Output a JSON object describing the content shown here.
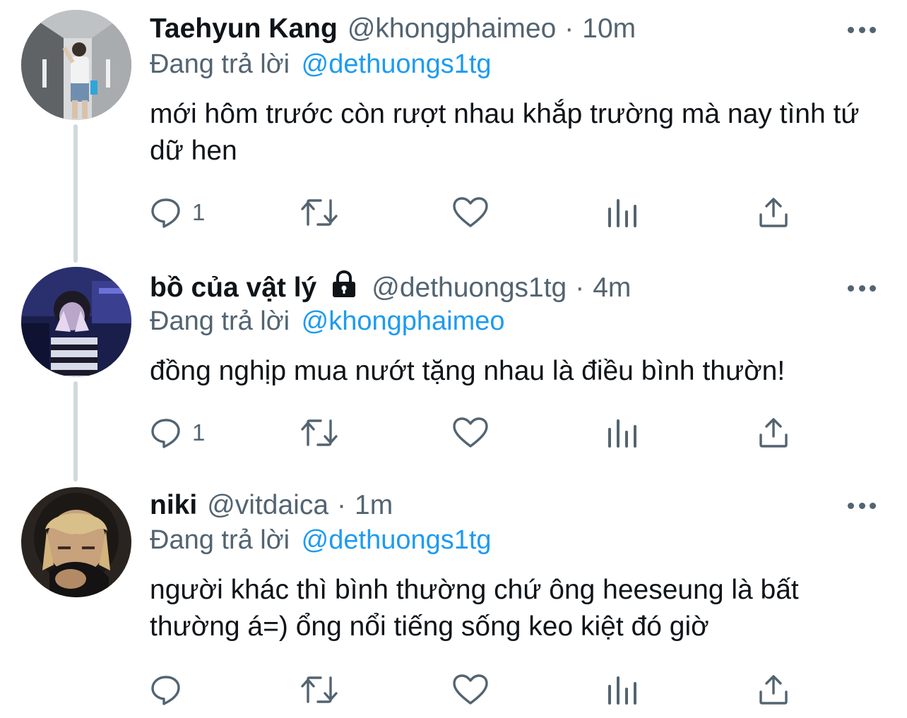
{
  "tweets": [
    {
      "name": "Taehyun Kang",
      "handle": "@khongphaimeo",
      "separator": "·",
      "time": "10m",
      "locked": false,
      "replying_prefix": "Đang trả lời",
      "replying_to": "@dethuongs1tg",
      "text": "mới hôm trước còn rượt nhau khắp trường mà nay tình tứ dữ hen",
      "reply_count": "1",
      "retweet_count": "",
      "like_count": ""
    },
    {
      "name": "bồ của vật lý",
      "handle": "@dethuongs1tg",
      "separator": "·",
      "time": "4m",
      "locked": true,
      "replying_prefix": "Đang trả lời",
      "replying_to": "@khongphaimeo",
      "text": "đồng nghịp mua nướt tặng nhau là điều bình thườn!",
      "reply_count": "1",
      "retweet_count": "",
      "like_count": ""
    },
    {
      "name": "niki",
      "handle": "@vitdaica",
      "separator": "·",
      "time": "1m",
      "locked": false,
      "replying_prefix": "Đang trả lời",
      "replying_to": "@dethuongs1tg",
      "text": "người khác thì bình thường chứ ông heeseung là bất thường á=) ổng nổi tiếng sống keo kiệt đó giờ",
      "reply_count": "",
      "retweet_count": "",
      "like_count": ""
    }
  ],
  "icons": {
    "reply": "speech-bubble-icon",
    "retweet": "retweet-icon",
    "like": "heart-icon",
    "analytics": "bar-chart-icon",
    "share": "share-icon",
    "more": "more-dots-icon",
    "lock": "lock-icon"
  },
  "colors": {
    "text": "#0f1419",
    "secondary": "#536471",
    "link": "#1d9bf0",
    "thread_line": "#cfd9de"
  }
}
